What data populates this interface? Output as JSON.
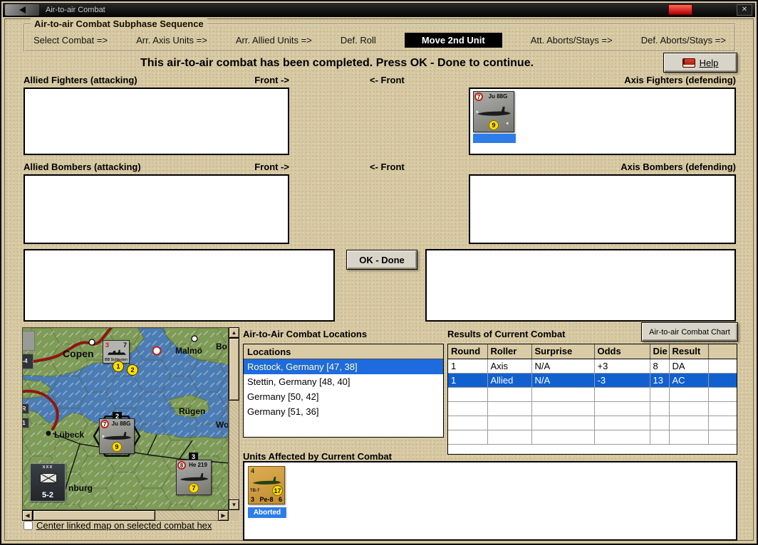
{
  "window": {
    "title": "Air-to-air Combat"
  },
  "icons": {
    "system_menu": "arrow-left-icon",
    "close": "✕",
    "star": "*",
    "scroll_up": "▲",
    "scroll_down": "▼",
    "scroll_left": "◀",
    "scroll_right": "▶",
    "help_book": "red-book-icon"
  },
  "subphase": {
    "title": "Air-to-air Combat Subphase Sequence",
    "phases": [
      "Select Combat =>",
      "Arr. Axis Units =>",
      "Arr. Allied Units =>",
      "Def. Roll",
      "Move 2nd Unit",
      "Att. Aborts/Stays =>",
      "Def. Aborts/Stays =>"
    ],
    "active_phase": "Move 2nd Unit"
  },
  "banner": {
    "message": "This air-to-air combat has been completed.  Press OK - Done to continue.",
    "help_label": "Help"
  },
  "sections": {
    "allied_fighters": "Allied Fighters (attacking)",
    "axis_fighters": "Axis Fighters (defending)",
    "allied_bombers": "Allied Bombers (attacking)",
    "axis_bombers": "Axis Bombers (defending)",
    "front_right": "Front ->",
    "front_left": "<- Front"
  },
  "buttons": {
    "ok_done": "OK - Done",
    "combat_chart": "Air-to-air Combat Chart"
  },
  "axis_fighter_unit": {
    "name": "Ju 88G",
    "air_to_air": "7",
    "range": "9"
  },
  "locations": {
    "title": "Air-to-Air Combat Locations",
    "header": "Locations",
    "items": [
      "Rostock, Germany [47, 38]",
      "Stettin, Germany [48, 40]",
      "Germany [50, 42]",
      "Germany [51, 36]"
    ],
    "selected_index": 0
  },
  "results": {
    "title": "Results of Current Combat",
    "columns": [
      "Round",
      "Roller",
      "Surprise",
      "Odds",
      "Die",
      "Result"
    ],
    "rows": [
      [
        "1",
        "Axis",
        "N/A",
        "+3",
        "8",
        "DA"
      ],
      [
        "1",
        "Allied",
        "N/A",
        "-3",
        "13",
        "AC"
      ]
    ],
    "selected_row_index": 1
  },
  "units_affected": {
    "title": "Units Affected by Current Combat",
    "unit": {
      "top_left": "4",
      "type": "TB-7",
      "name": "Pe-8",
      "bottom_left": "3",
      "bottom_right": "6",
      "range": "17",
      "status": "Aborted"
    }
  },
  "map": {
    "city_labels": [
      "Copen",
      "Malmö",
      "Bo",
      "Rügen",
      "Wol",
      "Lübeck",
      "nburg"
    ],
    "naval_counter": {
      "attack": "3",
      "defense": "7",
      "name": "BB Schlesien"
    },
    "naval_markers": [
      "1",
      "2"
    ],
    "ju88g": {
      "name": "Ju 88G",
      "air_to_air": "7",
      "range": "9",
      "stack_marker": "2"
    },
    "he219": {
      "name": "He 219",
      "air_to_air": "8",
      "range": "7",
      "stack_marker": "3"
    },
    "ground_unit": {
      "size": "xxx",
      "strength": "5-2"
    },
    "edge_labels": [
      "-4",
      "R",
      "1"
    ]
  },
  "checkbox": {
    "label": "Center linked map on selected combat hex",
    "checked": false
  }
}
